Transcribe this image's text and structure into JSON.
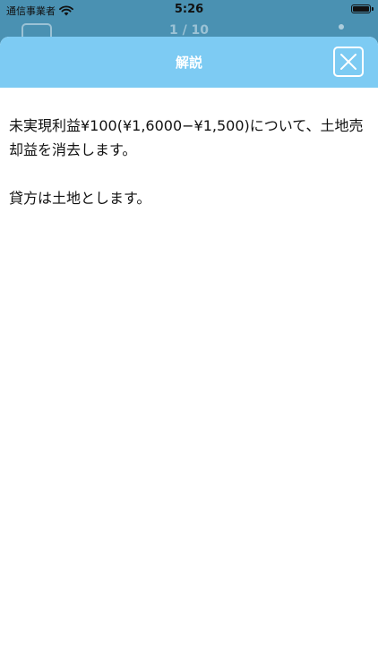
{
  "status_bar": {
    "carrier": "通信事業者",
    "time": "5:26"
  },
  "background": {
    "progress": "1 / 10"
  },
  "sheet": {
    "title": "解説",
    "paragraphs": [
      "未実現利益¥100(¥1,6000−¥1,500)について、土地売却益を消去します。",
      "貸方は土地とします。"
    ]
  },
  "colors": {
    "header": "#7dcbf3",
    "background_app": "#4a91b2"
  },
  "icons": {
    "close": "close-icon",
    "wifi": "wifi-icon",
    "battery": "battery-icon"
  }
}
